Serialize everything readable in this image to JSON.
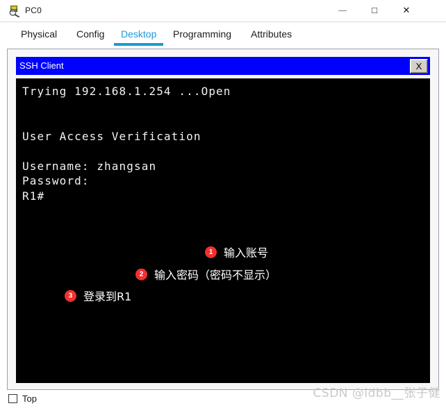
{
  "window": {
    "title": "PC0",
    "icon": "pc-magnifier-icon",
    "controls": {
      "minimize": "—",
      "maximize": "□",
      "close": "✕"
    }
  },
  "tabs": [
    {
      "label": "Physical",
      "active": false
    },
    {
      "label": "Config",
      "active": false
    },
    {
      "label": "Desktop",
      "active": true
    },
    {
      "label": "Programming",
      "active": false
    },
    {
      "label": "Attributes",
      "active": false
    }
  ],
  "ssh_client": {
    "title": "SSH Client",
    "close_label": "X",
    "terminal_lines": [
      "Trying 192.168.1.254 ...Open",
      "",
      "",
      "User Access Verification",
      "",
      "Username: zhangsan",
      "Password:",
      "R1#"
    ],
    "terminal_text": "Trying 192.168.1.254 ...Open\n\n\nUser Access Verification\n\nUsername: zhangsan\nPassword:\nR1#"
  },
  "annotations": [
    {
      "number": "1",
      "text": "输入账号"
    },
    {
      "number": "2",
      "text": "输入密码（密码不显示）"
    },
    {
      "number": "3",
      "text": "登录到R1"
    }
  ],
  "bottom": {
    "top_checkbox_label": "Top",
    "top_checkbox_checked": false
  },
  "watermark": "CSDN @idbb__张子健",
  "colors": {
    "accent": "#1a9ad7",
    "ssh_titlebar": "#0000ff",
    "terminal_bg": "#000000",
    "terminal_fg": "#f2f2f2",
    "annotation_badge": "#f03030",
    "watermark": "#c9c9c9"
  }
}
